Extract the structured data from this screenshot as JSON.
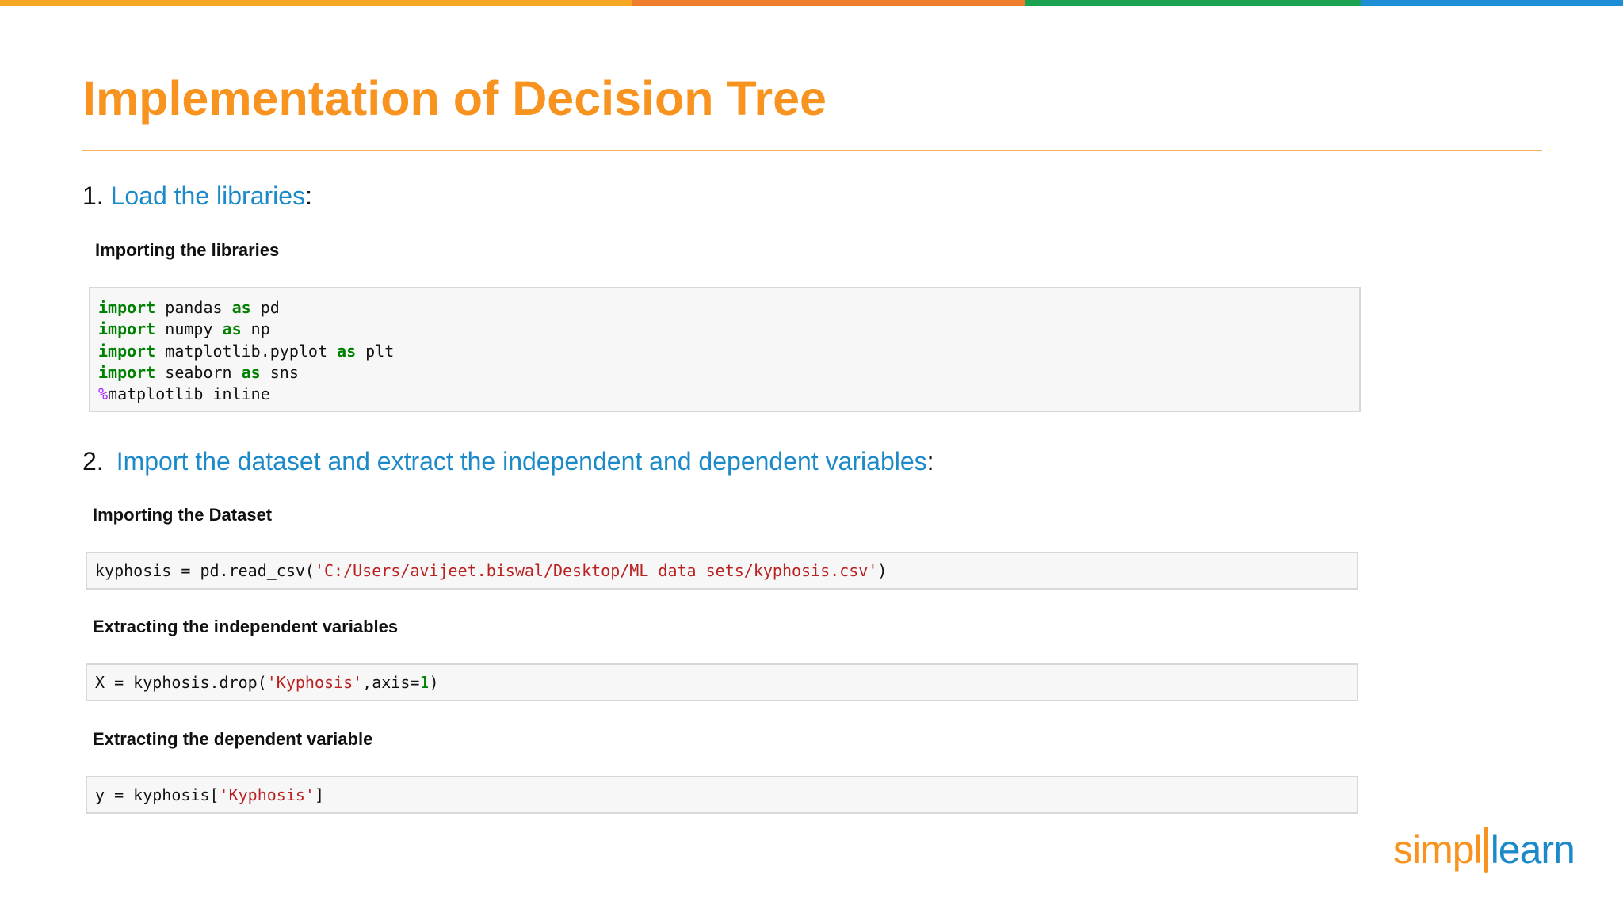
{
  "slide": {
    "title": "Implementation of Decision Tree",
    "colors": {
      "title": "#f7931e",
      "link": "#1c8ac8",
      "accent_bar": [
        "#f5a623",
        "#ee7d2c",
        "#1aa250",
        "#1e8fd6"
      ]
    }
  },
  "step1": {
    "number": "1.",
    "heading": "Load the libraries",
    "suffix": ":"
  },
  "step2": {
    "number": "2.",
    "heading": "Import the dataset and extract the independent and dependent variables",
    "suffix": ":"
  },
  "sections": {
    "importing_libraries": {
      "label": "Importing the libraries",
      "lines": [
        {
          "kw": "import",
          "mod": " pandas ",
          "as": "as",
          "alias": " pd"
        },
        {
          "kw": "import",
          "mod": " numpy ",
          "as": "as",
          "alias": " np"
        },
        {
          "kw": "import",
          "mod": " matplotlib.pyplot ",
          "as": "as",
          "alias": " plt"
        },
        {
          "kw": "import",
          "mod": " seaborn ",
          "as": "as",
          "alias": " sns"
        }
      ],
      "magic_symbol": "%",
      "magic_text": "matplotlib inline"
    },
    "importing_dataset": {
      "label": "Importing the Dataset",
      "code_prefix": "kyphosis = pd.read_csv(",
      "code_string": "'C:/Users/avijeet.biswal/Desktop/ML data sets/kyphosis.csv'",
      "code_suffix": ")"
    },
    "independent_vars": {
      "label": "Extracting the independent variables",
      "code_prefix": "X = kyphosis.drop(",
      "code_string": "'Kyphosis'",
      "code_middle": ",axis=",
      "code_number": "1",
      "code_suffix": ")"
    },
    "dependent_var": {
      "label": "Extracting the dependent variable",
      "code_prefix": "y = kyphosis[",
      "code_string": "'Kyphosis'",
      "code_suffix": "]"
    }
  },
  "logo": {
    "part1": "simpl",
    "part2": "learn"
  }
}
